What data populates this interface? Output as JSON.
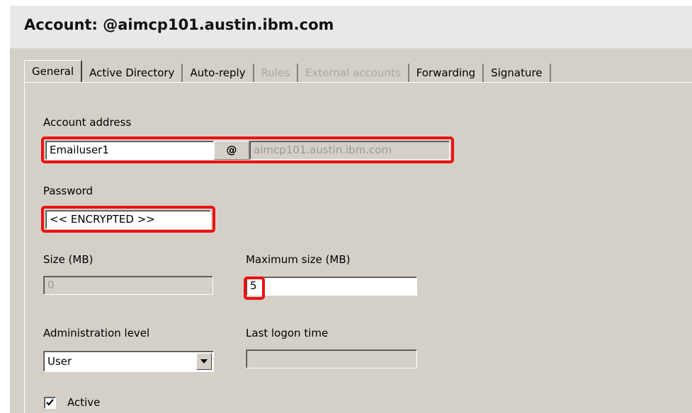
{
  "window": {
    "title": "Account: @aimcp101.austin.ibm.com"
  },
  "tabs": [
    {
      "label": "General",
      "state": "active"
    },
    {
      "label": "Active Directory",
      "state": "enabled"
    },
    {
      "label": "Auto-reply",
      "state": "enabled"
    },
    {
      "label": "Rules",
      "state": "disabled"
    },
    {
      "label": "External accounts",
      "state": "disabled"
    },
    {
      "label": "Forwarding",
      "state": "enabled"
    },
    {
      "label": "Signature",
      "state": "enabled"
    }
  ],
  "form": {
    "account_address": {
      "label": "Account address",
      "user": "Emailuser1",
      "at_symbol": "@",
      "domain": "aimcp101.austin.ibm.com"
    },
    "password": {
      "label": "Password",
      "value": "<< ENCRYPTED >>"
    },
    "size": {
      "label": "Size (MB)",
      "value": "0"
    },
    "max_size": {
      "label": "Maximum size (MB)",
      "value": "5"
    },
    "admin_level": {
      "label": "Administration level",
      "value": "User"
    },
    "last_logon": {
      "label": "Last logon time",
      "value": ""
    },
    "active": {
      "label": "Active",
      "checked": true
    }
  },
  "icons": {
    "dropdown": "chevron-down-icon",
    "checkbox_mark": "checkmark-icon"
  },
  "colors": {
    "dialog_background": "#d4d0c8",
    "title_background": "#e8e8e8",
    "highlight": "#ee1111",
    "disabled_text": "#a8a8a8"
  }
}
